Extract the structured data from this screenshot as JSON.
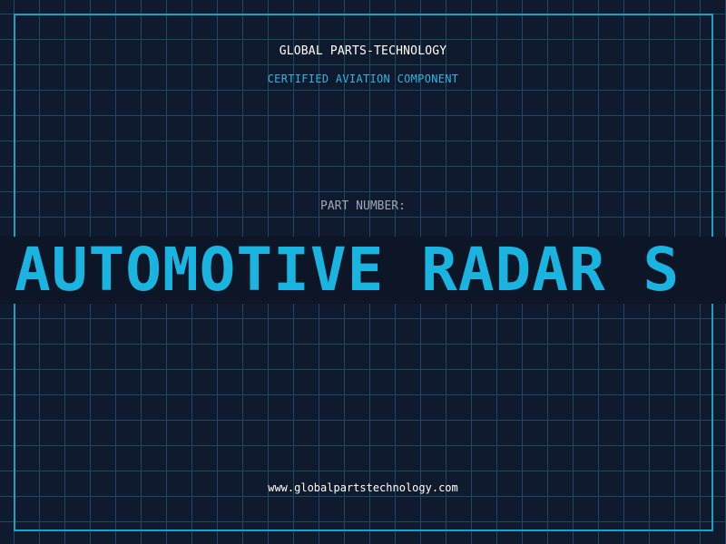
{
  "header": {
    "company": "GLOBAL PARTS-TECHNOLOGY",
    "subtitle": "CERTIFIED AVIATION COMPONENT"
  },
  "part": {
    "label": "PART NUMBER:",
    "name": "AUTOMOTIVE RADAR S"
  },
  "footer": {
    "url": "www.globalpartstechnology.com"
  },
  "colors": {
    "background": "#101a2e",
    "grid": "#1c4a5f",
    "frame": "#1fa0c8",
    "accent": "#1ab4e0"
  }
}
